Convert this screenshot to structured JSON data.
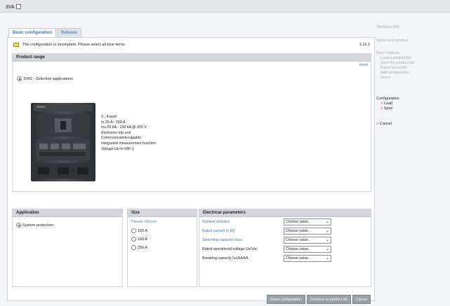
{
  "window": {
    "title": "3VA"
  },
  "tabs": [
    {
      "label": "Basic configuration"
    },
    {
      "label": "Release"
    }
  ],
  "status": {
    "message": "The configuration is incomplete. Please select all blue items.",
    "version": "1.16.1"
  },
  "product_range": {
    "title": "Product range",
    "reset": "reset",
    "option": "3VA2 - Selective applications",
    "specs": [
      "3-, 4-pole",
      "In 25 A - 250 A",
      "Icu 55 kA - 150 kA @ 415 V",
      "Electronic trip unit",
      "Communication-capable",
      "Integrated measurement function",
      "Voltage Ue to 690 V"
    ]
  },
  "application": {
    "title": "Application",
    "option": "System protection"
  },
  "size": {
    "title": "Size",
    "hint": "Please choose",
    "options": [
      "100 A",
      "160 A",
      "250 A"
    ]
  },
  "electrical": {
    "title": "Electrical parameters",
    "params": [
      {
        "label": "Number of poles",
        "value": "Choose value..."
      },
      {
        "label": "Rated current In [A]",
        "value": "Choose value..."
      },
      {
        "label": "Switching capacity class",
        "value": "Choose value..."
      },
      {
        "label": "Rated operational voltage Ue/Vac",
        "value": "Choose value..."
      },
      {
        "label": "Breaking capacity Icu/kA/kA",
        "value": "Choose value..."
      }
    ]
  },
  "buttons": {
    "reset": "Reset configuration",
    "continue": "Continue to product list",
    "cancel": "Cancel"
  },
  "sidebar": {
    "version_info": "Version info",
    "select_next": "Select next product",
    "your_products": "Your Products",
    "product_items": [
      "Load a product list",
      "Save the product list",
      "Export as txt file",
      "Add configuration",
      "Reset"
    ],
    "configuration": "Configuration",
    "load": "Load",
    "save": "Save",
    "cancel": "Cancel"
  }
}
